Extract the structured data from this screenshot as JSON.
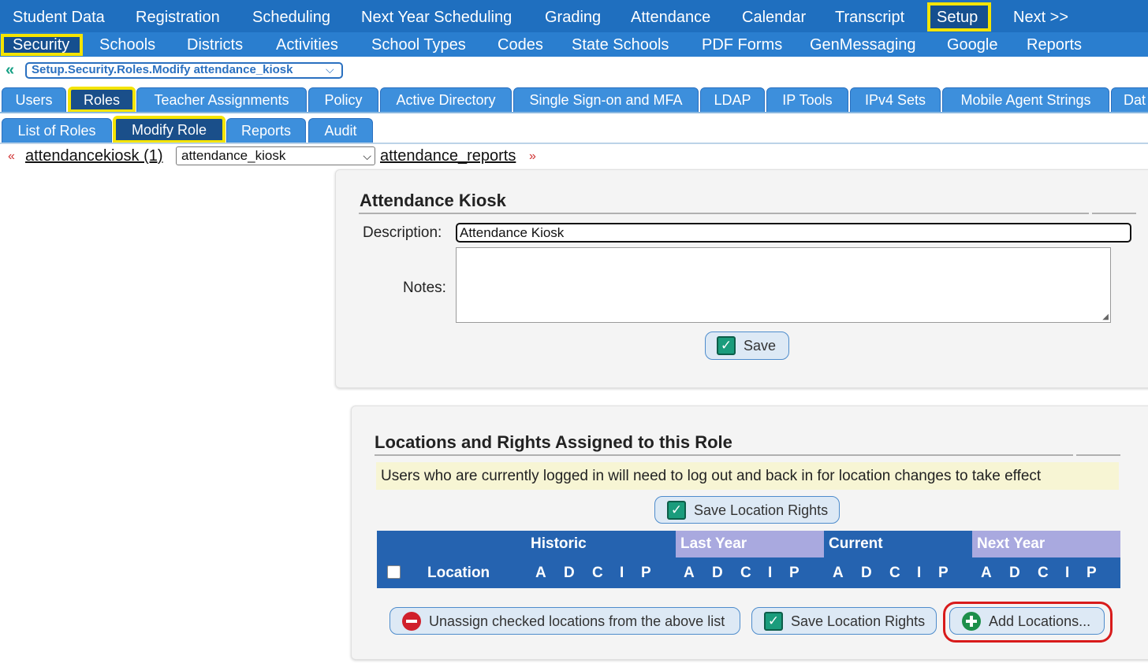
{
  "nav": {
    "top": [
      "Student Data",
      "Registration",
      "Scheduling",
      "Next Year Scheduling",
      "Grading",
      "Attendance",
      "Calendar",
      "Transcript",
      "Setup",
      "Next >>"
    ],
    "sub": [
      "Security",
      "Schools",
      "Districts",
      "Activities",
      "School Types",
      "Codes",
      "State Schools",
      "PDF Forms",
      "GenMessaging",
      "Google",
      "Reports"
    ]
  },
  "breadcrumb": {
    "value": "Setup.Security.Roles.Modify attendance_kiosk"
  },
  "tabs": [
    "Users",
    "Roles",
    "Teacher Assignments",
    "Policy",
    "Active Directory",
    "Single Sign-on and MFA",
    "LDAP",
    "IP Tools",
    "IPv4 Sets",
    "Mobile Agent Strings",
    "Dat"
  ],
  "subtabs": [
    "List of Roles",
    "Modify Role",
    "Reports",
    "Audit"
  ],
  "role_nav": {
    "prev_link": "attendancekiosk (1)",
    "selected_role": "attendance_kiosk",
    "next_link": "attendance_reports"
  },
  "role_panel": {
    "title": "Attendance Kiosk",
    "description_label": "Description:",
    "description_value": "Attendance Kiosk",
    "notes_label": "Notes:",
    "save_label": "Save"
  },
  "locations_panel": {
    "title": "Locations and Rights Assigned to this Role",
    "notice": "Users who are currently logged in will need to log out and back in for location changes to take effect",
    "save_top_label": "Save Location Rights",
    "groups": [
      "Historic",
      "Last Year",
      "Current",
      "Next Year"
    ],
    "location_header": "Location",
    "rights": [
      "A",
      "D",
      "C",
      "I",
      "P"
    ],
    "unassign_label": "Unassign checked locations from the above list",
    "save_bottom_label": "Save Location Rights",
    "add_label": "Add Locations..."
  },
  "colors": {
    "nav_dark": "#1f6fbf",
    "nav_light": "#2a7ecf",
    "highlight_yellow": "#f4e400",
    "table_header": "#2563b0",
    "table_header_alt": "#a9a9df",
    "annotation_red": "#d81b1b"
  }
}
